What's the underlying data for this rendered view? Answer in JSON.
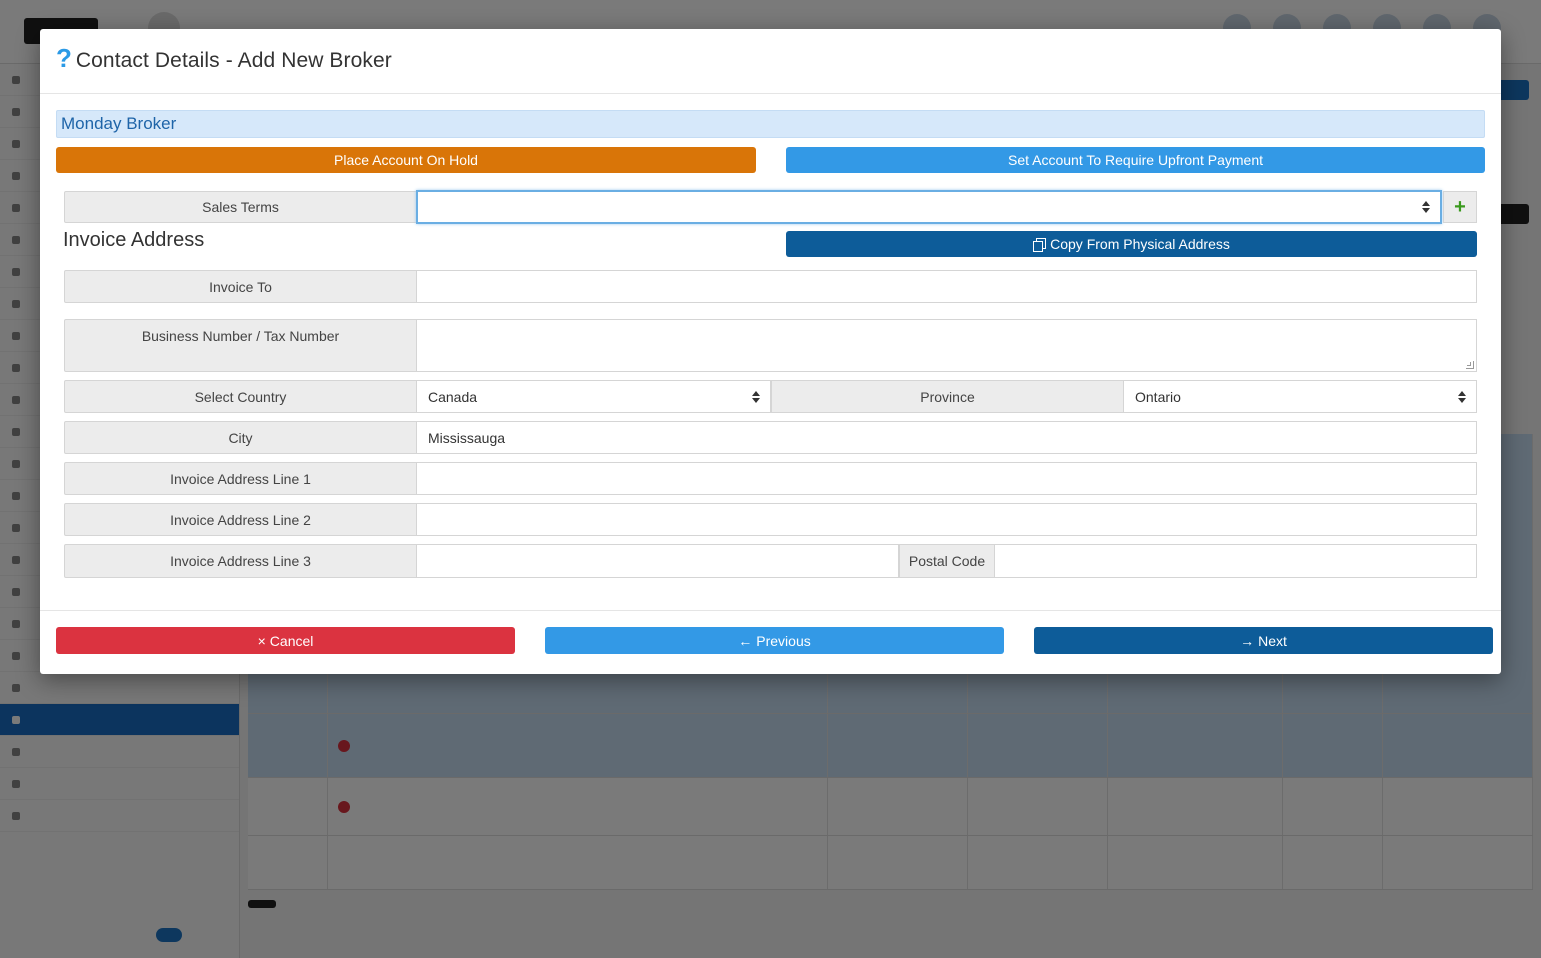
{
  "modal": {
    "title": "Contact Details - Add New Broker",
    "help_icon": "help-icon",
    "company_name": "Monday Broker",
    "buttons": {
      "hold": "Place Account On Hold",
      "upfront": "Set Account To Require Upfront Payment",
      "copy_address": "Copy From Physical Address"
    },
    "sales_terms": {
      "label": "Sales Terms",
      "value": "",
      "add_icon": "+"
    },
    "invoice_section_title": "Invoice Address",
    "fields": {
      "invoice_to": {
        "label": "Invoice To",
        "value": ""
      },
      "business_number": {
        "label": "Business Number / Tax Number",
        "value": ""
      },
      "country": {
        "label": "Select Country",
        "value": "Canada"
      },
      "province": {
        "label": "Province",
        "value": "Ontario"
      },
      "city": {
        "label": "City",
        "value": "Mississauga"
      },
      "line1": {
        "label": "Invoice Address Line 1",
        "value": ""
      },
      "line2": {
        "label": "Invoice Address Line 2",
        "value": ""
      },
      "line3": {
        "label": "Invoice Address Line 3",
        "value": ""
      },
      "postal_code": {
        "label": "Postal Code",
        "value": ""
      }
    },
    "footer": {
      "cancel": "Cancel",
      "cancel_icon": "×",
      "previous": "Previous",
      "previous_icon": "←",
      "next": "Next",
      "next_icon": "→"
    }
  },
  "colors": {
    "orange": "#d97508",
    "light_blue": "#3399e6",
    "dark_blue": "#0d5c99",
    "red": "#db3340",
    "banner_bg": "#d6e8fa"
  }
}
